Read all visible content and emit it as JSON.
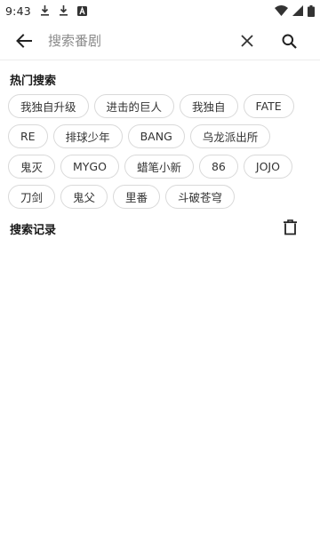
{
  "status_bar": {
    "time": "9:43",
    "left_icons": [
      "download-icon",
      "download-icon",
      "a-badge-icon"
    ],
    "right_icons": [
      "wifi-icon",
      "signal-icon",
      "battery-icon"
    ]
  },
  "search": {
    "placeholder": "搜索番剧",
    "value": ""
  },
  "hot_search": {
    "title": "热门搜索",
    "tags": [
      "我独自升级",
      "进击的巨人",
      "我独自",
      "FATE",
      "RE",
      "排球少年",
      "BANG",
      "乌龙派出所",
      "鬼灭",
      "MYGO",
      "蜡笔小新",
      "86",
      "JOJO",
      "刀剑",
      "鬼父",
      "里番",
      "斗破苍穹"
    ]
  },
  "history": {
    "title": "搜索记录",
    "items": []
  }
}
